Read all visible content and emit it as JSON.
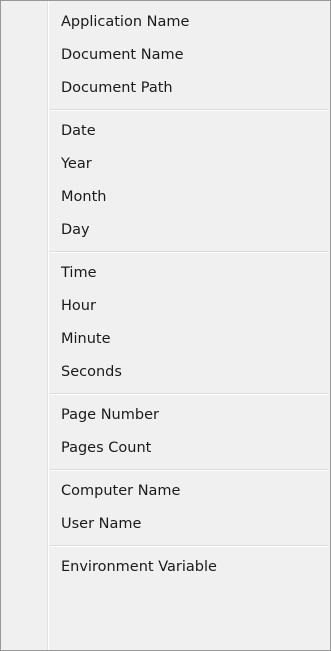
{
  "menu": {
    "groups": [
      {
        "items": [
          "Application Name",
          "Document Name",
          "Document Path"
        ]
      },
      {
        "items": [
          "Date",
          "Year",
          "Month",
          "Day"
        ]
      },
      {
        "items": [
          "Time",
          "Hour",
          "Minute",
          "Seconds"
        ]
      },
      {
        "items": [
          "Page Number",
          "Pages Count"
        ]
      },
      {
        "items": [
          "Computer Name",
          "User Name"
        ]
      },
      {
        "items": [
          "Environment Variable"
        ]
      }
    ]
  },
  "colors": {
    "background": "#f0f0f0",
    "border": "#979797",
    "text": "#1a1a1a",
    "separator": "#dcdcdc"
  }
}
